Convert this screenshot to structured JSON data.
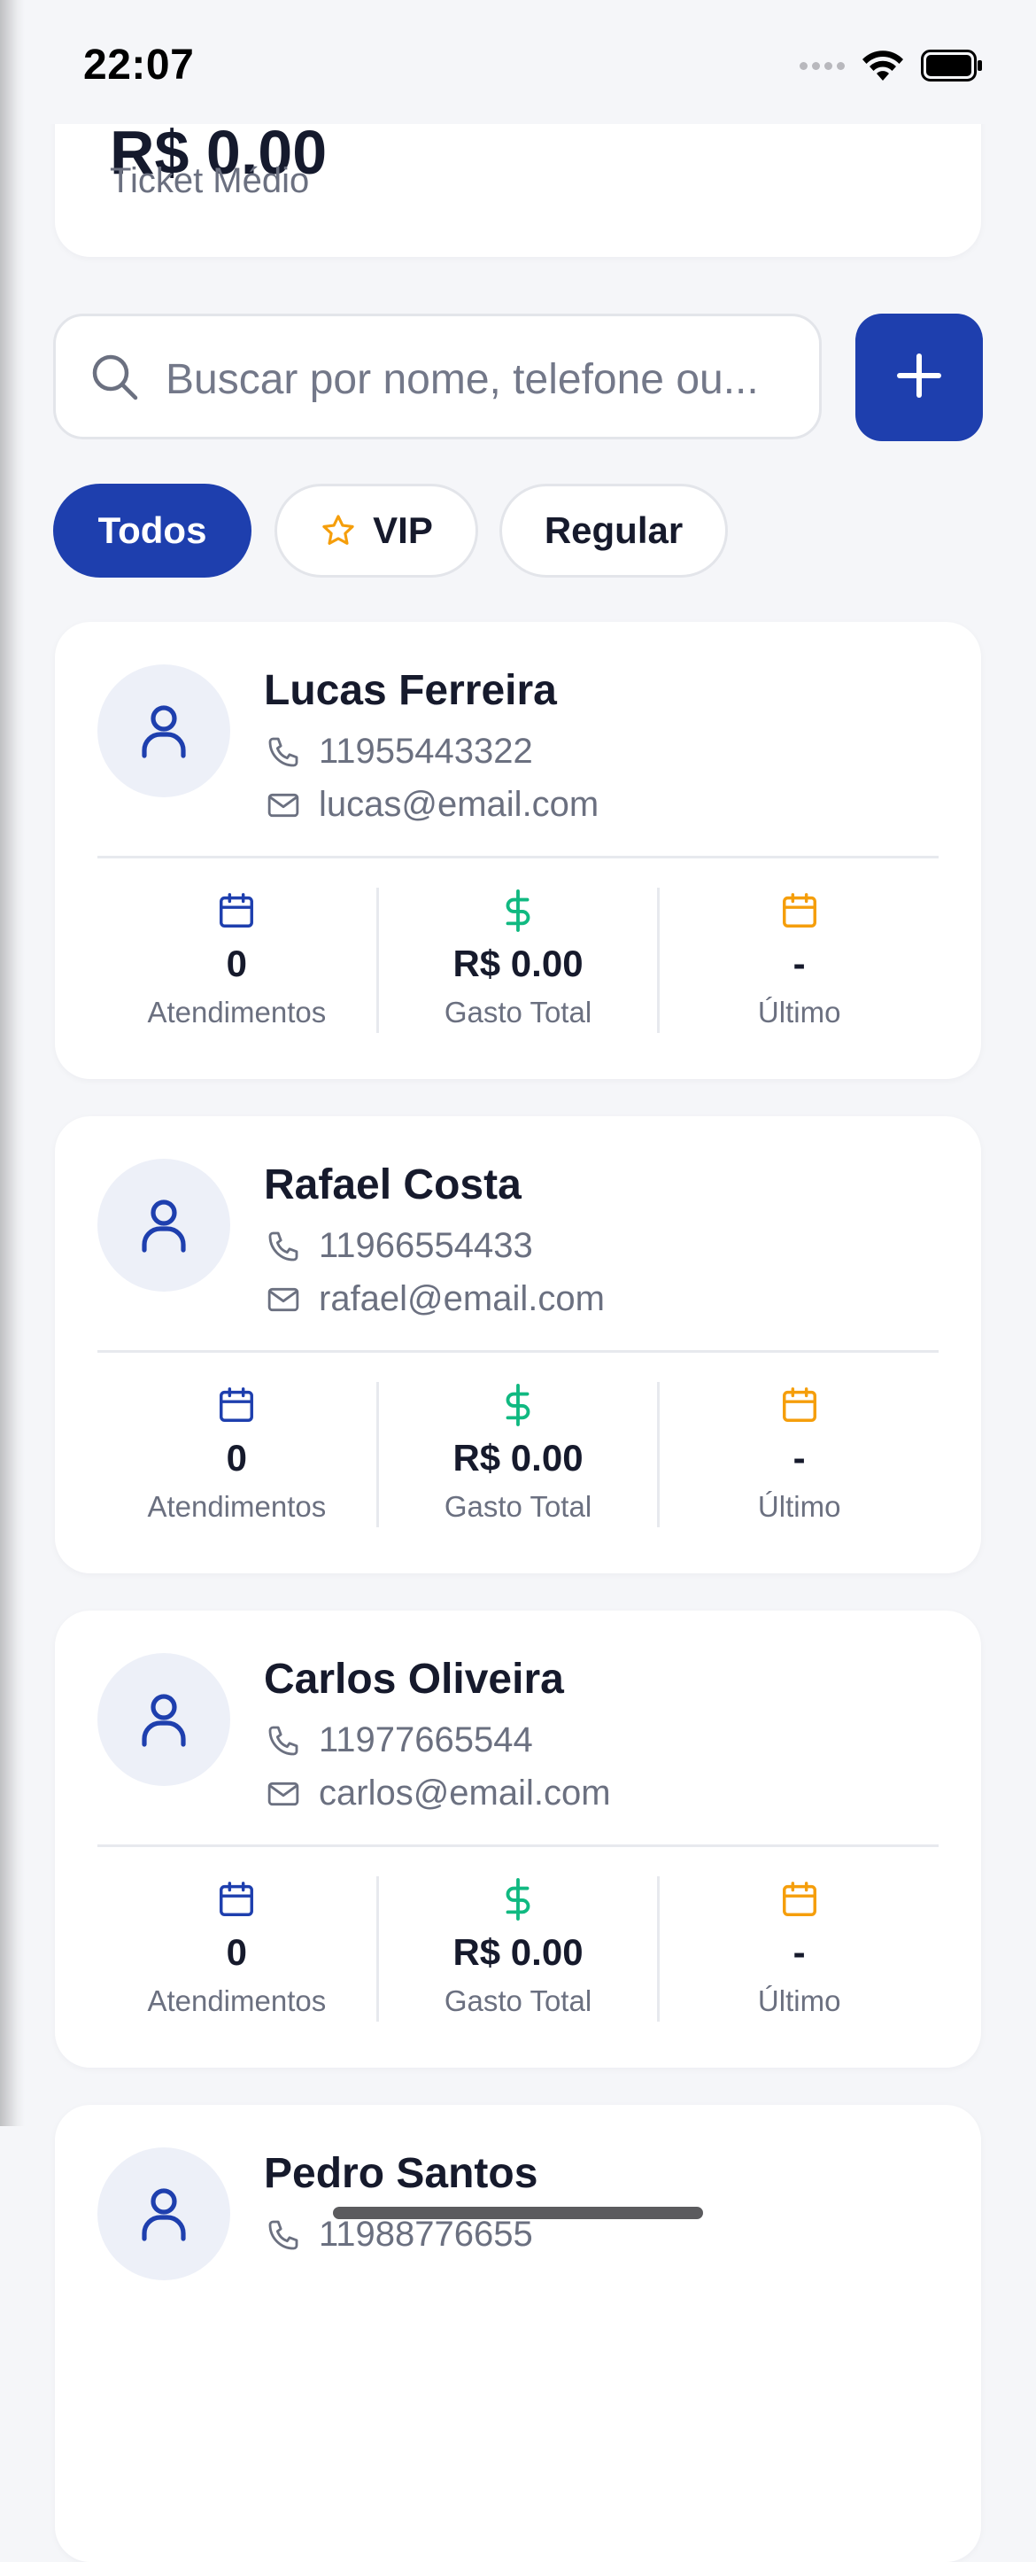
{
  "status_bar": {
    "time": "22:07"
  },
  "summary": {
    "value": "R$ 0.00",
    "label": "Ticket Médio"
  },
  "search": {
    "placeholder": "Buscar por nome, telefone ou..."
  },
  "filters": [
    {
      "label": "Todos",
      "active": true
    },
    {
      "label": "VIP",
      "icon": "star-icon",
      "active": false
    },
    {
      "label": "Regular",
      "active": false
    }
  ],
  "clients": [
    {
      "name": "Lucas Ferreira",
      "phone": "11955443322",
      "email": "lucas@email.com",
      "stats": [
        {
          "value": "0",
          "label": "Atendimentos",
          "icon": "calendar-icon"
        },
        {
          "value": "R$ 0.00",
          "label": "Gasto Total",
          "icon": "dollar-icon"
        },
        {
          "value": "-",
          "label": "Último",
          "icon": "calendar-icon"
        }
      ]
    },
    {
      "name": "Rafael Costa",
      "phone": "11966554433",
      "email": "rafael@email.com",
      "stats": [
        {
          "value": "0",
          "label": "Atendimentos",
          "icon": "calendar-icon"
        },
        {
          "value": "R$ 0.00",
          "label": "Gasto Total",
          "icon": "dollar-icon"
        },
        {
          "value": "-",
          "label": "Último",
          "icon": "calendar-icon"
        }
      ]
    },
    {
      "name": "Carlos Oliveira",
      "phone": "11977665544",
      "email": "carlos@email.com",
      "stats": [
        {
          "value": "0",
          "label": "Atendimentos",
          "icon": "calendar-icon"
        },
        {
          "value": "R$ 0.00",
          "label": "Gasto Total",
          "icon": "dollar-icon"
        },
        {
          "value": "-",
          "label": "Último",
          "icon": "calendar-icon"
        }
      ]
    },
    {
      "name": "Pedro Santos",
      "phone": "11988776655",
      "email": "",
      "stats": []
    }
  ],
  "colors": {
    "primary": "#1e3fae",
    "money_green": "#10b981",
    "last_orange": "#f59e0b",
    "text_dark": "#161a2c",
    "text_muted": "#6b7080"
  }
}
